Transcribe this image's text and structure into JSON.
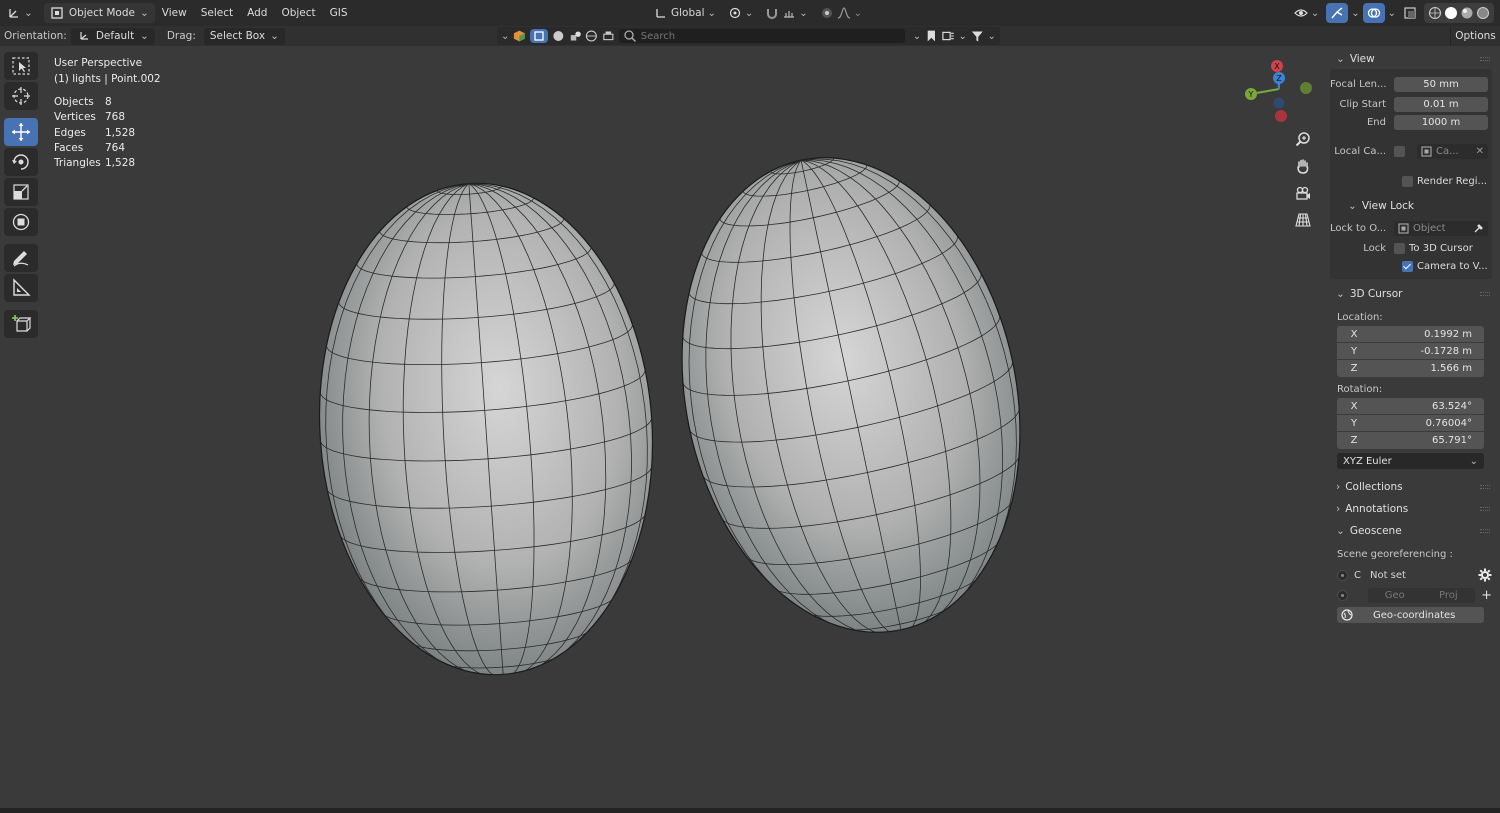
{
  "header": {
    "mode": "Object Mode",
    "menus": [
      "View",
      "Select",
      "Add",
      "Object",
      "GIS"
    ],
    "transform_orientation": "Global"
  },
  "tool_settings": {
    "orientation_label": "Orientation:",
    "orientation_value": "Default",
    "drag_label": "Drag:",
    "drag_value": "Select Box",
    "search_placeholder": "Search",
    "options_label": "Options"
  },
  "viewport": {
    "view_name": "User Perspective",
    "context_line": "(1) lights | Point.002",
    "stats": [
      {
        "key": "Objects",
        "value": "8"
      },
      {
        "key": "Vertices",
        "value": "768"
      },
      {
        "key": "Edges",
        "value": "1,528"
      },
      {
        "key": "Faces",
        "value": "764"
      },
      {
        "key": "Triangles",
        "value": "1,528"
      }
    ],
    "gizmo_axes": {
      "x": "X",
      "y": "Y",
      "z": "Z"
    },
    "colors": {
      "x_axis": "#d0434d",
      "y_axis": "#7aa83a",
      "z_axis": "#3c83d8",
      "accent": "#4772b3"
    }
  },
  "npanel": {
    "view_section": "View",
    "focal_length_label": "Focal Len...",
    "focal_length_value": "50 mm",
    "clip_start_label": "Clip Start",
    "clip_start_value": "0.01 m",
    "clip_end_label": "End",
    "clip_end_value": "1000 m",
    "local_camera_label": "Local Ca...",
    "local_camera_value": "Ca...",
    "render_region_label": "Render Regi...",
    "view_lock_section": "View Lock",
    "lock_to_object_label": "Lock to O...",
    "lock_to_object_placeholder": "Object",
    "lock_label": "Lock",
    "to_3d_cursor_label": "To 3D Cursor",
    "camera_to_view_label": "Camera to V...",
    "cursor_section": "3D Cursor",
    "location_label": "Location:",
    "location": [
      {
        "axis": "X",
        "value": "0.1992 m"
      },
      {
        "axis": "Y",
        "value": "-0.1728 m"
      },
      {
        "axis": "Z",
        "value": "1.566 m"
      }
    ],
    "rotation_label": "Rotation:",
    "rotation": [
      {
        "axis": "X",
        "value": "63.524°"
      },
      {
        "axis": "Y",
        "value": "0.76004°"
      },
      {
        "axis": "Z",
        "value": "65.791°"
      }
    ],
    "rotation_mode": "XYZ Euler",
    "collections_section": "Collections",
    "annotations_section": "Annotations",
    "geoscene_section": "Geoscene",
    "georef_label": "Scene georeferencing :",
    "georef_c": "C",
    "georef_status": "Not set",
    "geo_btn": "Geo",
    "proj_btn": "Proj",
    "geo_coordinates_btn": "Geo-coordinates"
  }
}
